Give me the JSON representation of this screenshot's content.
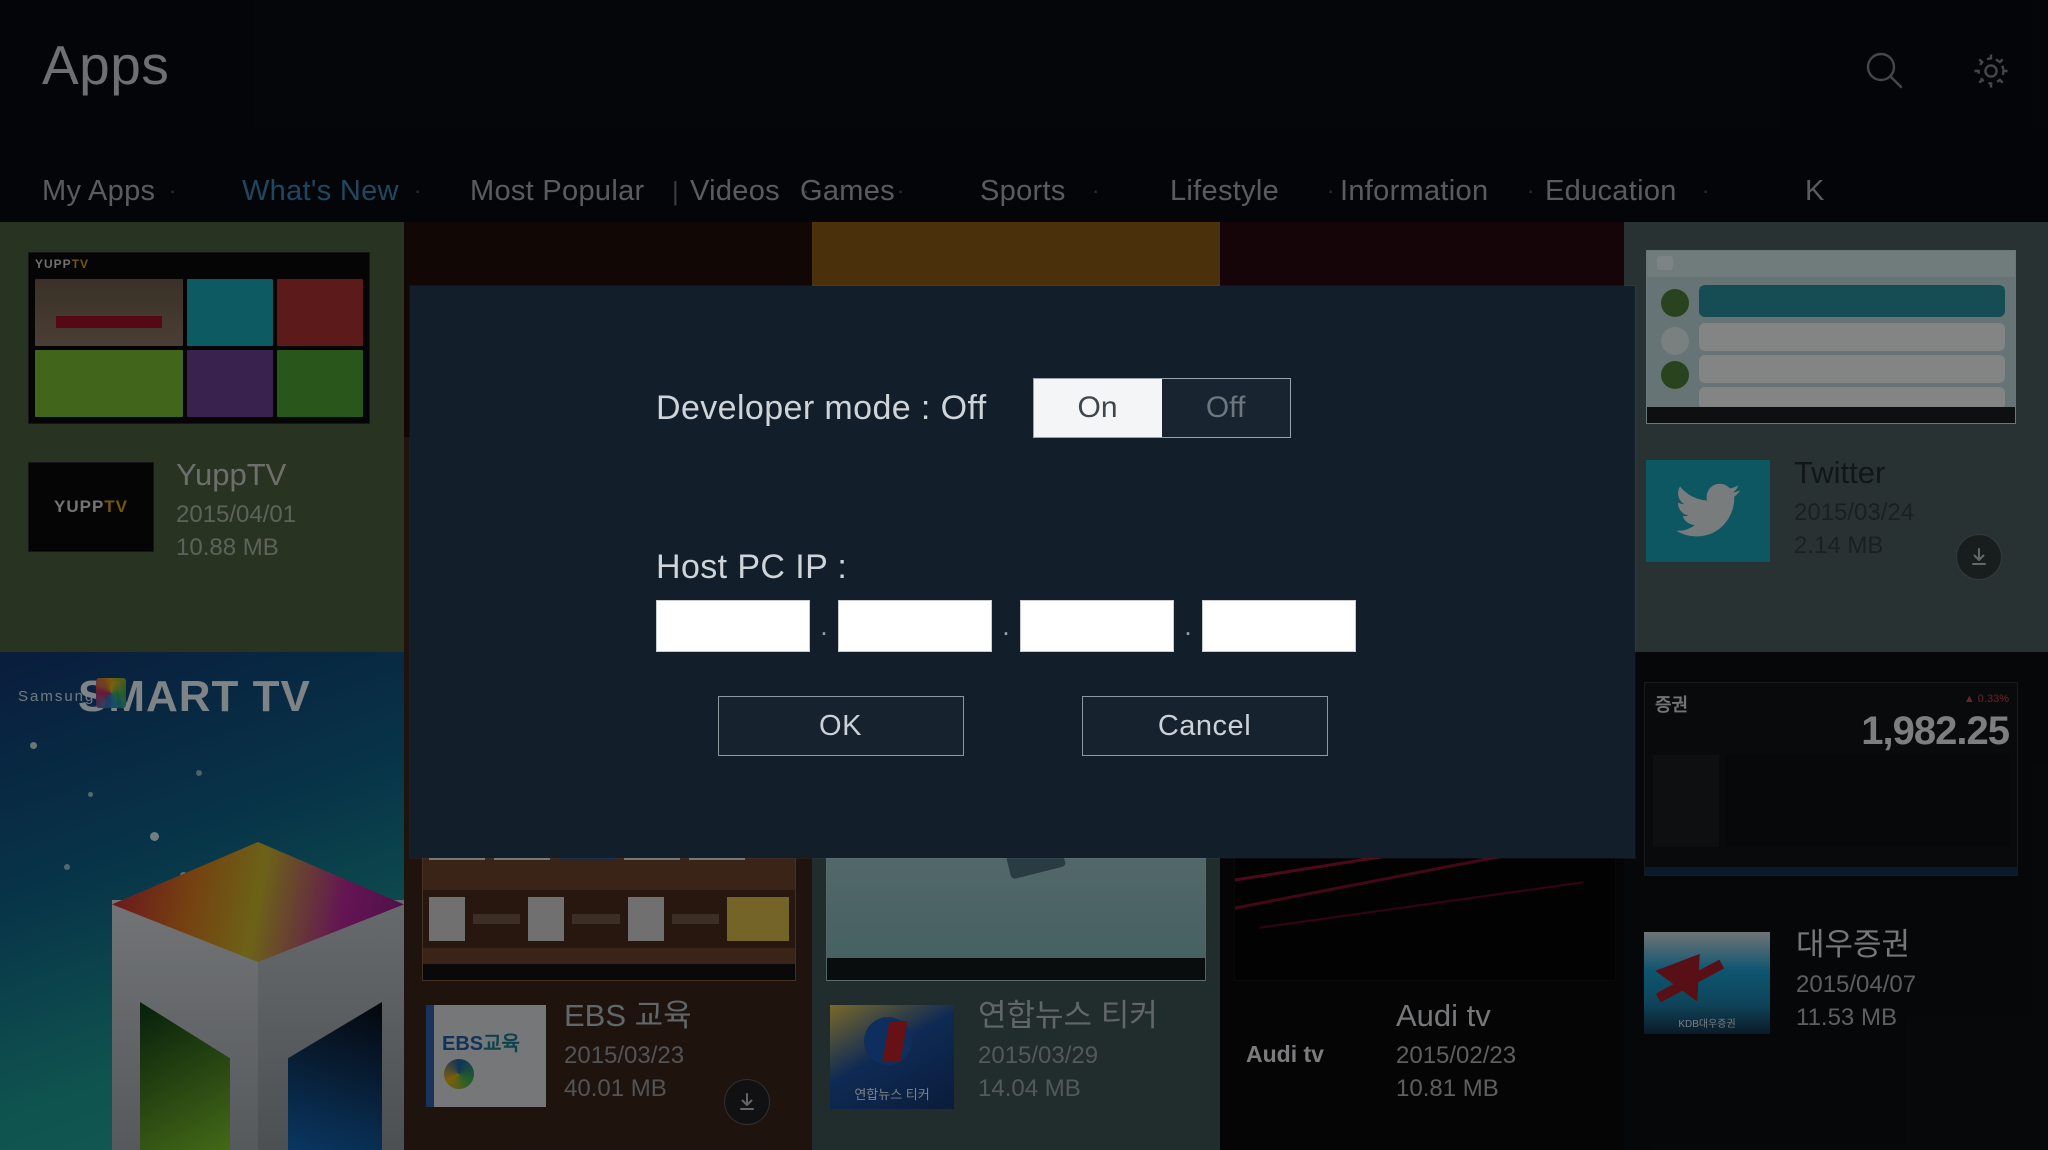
{
  "header": {
    "title": "Apps",
    "icons": [
      {
        "name": "search-icon",
        "label": "Search"
      },
      {
        "name": "gear-icon",
        "label": "Settings"
      }
    ]
  },
  "nav": {
    "items": [
      {
        "label": "My Apps",
        "active": false,
        "sep": "·"
      },
      {
        "label": "What's New",
        "active": true,
        "sep": "·"
      },
      {
        "label": "Most Popular",
        "active": false,
        "sep": "|"
      },
      {
        "label": "Videos",
        "active": false,
        "sep": "·"
      },
      {
        "label": "Games",
        "active": false,
        "sep": "·"
      },
      {
        "label": "Sports",
        "active": false,
        "sep": "·"
      },
      {
        "label": "Lifestyle",
        "active": false,
        "sep": "·"
      },
      {
        "label": "Information",
        "active": false,
        "sep": "·"
      },
      {
        "label": "Education",
        "active": false,
        "sep": "·"
      },
      {
        "label": "K",
        "active": false,
        "sep": ""
      }
    ]
  },
  "apps": {
    "yupptv": {
      "name": "YuppTV",
      "date": "2015/04/01",
      "size": "10.88 MB",
      "logo": "YUPPTV",
      "download": false
    },
    "twitter": {
      "name": "Twitter",
      "date": "2015/03/24",
      "size": "2.14 MB",
      "logo": "twitter-bird",
      "download": true
    },
    "ebs": {
      "name": "EBS 교육",
      "date": "2015/03/23",
      "size": "40.01 MB",
      "logo": "EBS 교육",
      "download": true
    },
    "yonhap": {
      "name": "연합뉴스 티커",
      "date": "2015/03/29",
      "size": "14.04 MB",
      "logo": "연합뉴스 티커",
      "download": false
    },
    "auditv": {
      "name": "Audi tv",
      "date": "2015/02/23",
      "size": "10.81 MB",
      "logo": "Audi tv",
      "download": false
    },
    "daewoo": {
      "name": "대우증권",
      "date": "2015/04/07",
      "size": "11.53 MB",
      "logo": "KDB대우증권",
      "download": false
    }
  },
  "promo": {
    "smarttv": {
      "brand": "Samsung",
      "title": "SMART TV"
    },
    "daewoo_index": {
      "value": "1,982.25",
      "label": "증권"
    }
  },
  "dialog": {
    "dev_mode_label": "Developer mode : Off",
    "toggle": {
      "on": "On",
      "off": "Off",
      "selected": "On"
    },
    "host_label": "Host PC IP :",
    "ip": {
      "octet1": "",
      "octet2": "",
      "octet3": "",
      "octet4": "",
      "separator": "."
    },
    "ok": "OK",
    "cancel": "Cancel"
  },
  "colors": {
    "topbar_bg": "#080b10",
    "dialog_bg": "#121e2a",
    "accent_active": "#3d8fc4",
    "toggle_selected_bg": "#f4f5f6",
    "gold_tile": "#8a5c16"
  }
}
